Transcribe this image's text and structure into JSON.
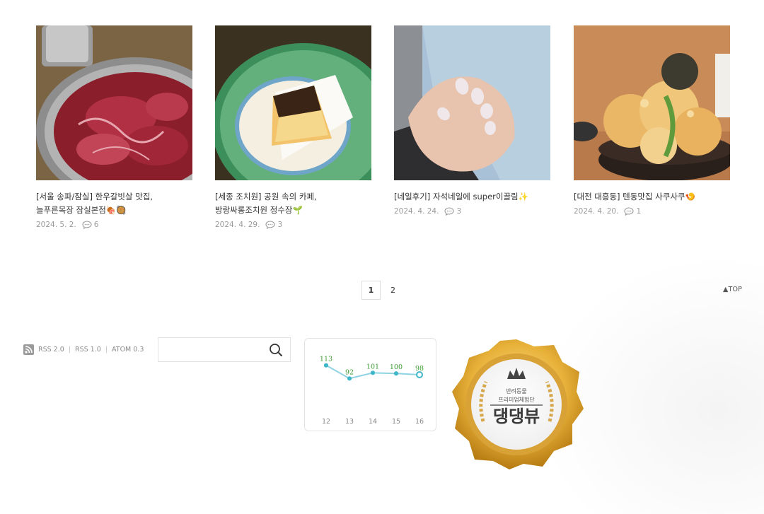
{
  "posts": [
    {
      "title": "[서울 송파/잠실] 한우갈빗살 맛집, 늘푸른목장 잠실본점🍖🥘",
      "date": "2024. 5. 2.",
      "comments": "6",
      "thumb": "grilled-beef-photo"
    },
    {
      "title": "[세종 조치원] 공원 속의 카페, 방랑싸롱조치원 정수장🌱",
      "date": "2024. 4. 29.",
      "comments": "3",
      "thumb": "cheesecake-photo"
    },
    {
      "title": "[네일후기] 자석네일에 super이끌림✨",
      "date": "2024. 4. 24.",
      "comments": "3",
      "thumb": "nail-photo"
    },
    {
      "title": "[대전 대흥동] 텐동맛집 사쿠사쿠🍤",
      "date": "2024. 4. 20.",
      "comments": "1",
      "thumb": "tendon-photo"
    }
  ],
  "pagination": {
    "pages": [
      "1",
      "2"
    ],
    "current": "1"
  },
  "top_link": "▲TOP",
  "feeds": {
    "rss2": "RSS 2.0",
    "rss1": "RSS 1.0",
    "atom": "ATOM 0.3"
  },
  "search": {
    "placeholder": "",
    "value": ""
  },
  "chart_data": {
    "type": "line",
    "categories": [
      "12",
      "13",
      "14",
      "15",
      "16"
    ],
    "values": [
      113,
      92,
      101,
      100,
      98
    ],
    "title": "",
    "xlabel": "",
    "ylabel": "",
    "grid": false,
    "colors": {
      "line": "#8fd3e3",
      "point": "#3fb7c9",
      "label": "#3a9d2f"
    }
  },
  "badge": {
    "line1": "반려동물",
    "line2": "프리미엄체험단",
    "brand": "댕댕뷰"
  }
}
